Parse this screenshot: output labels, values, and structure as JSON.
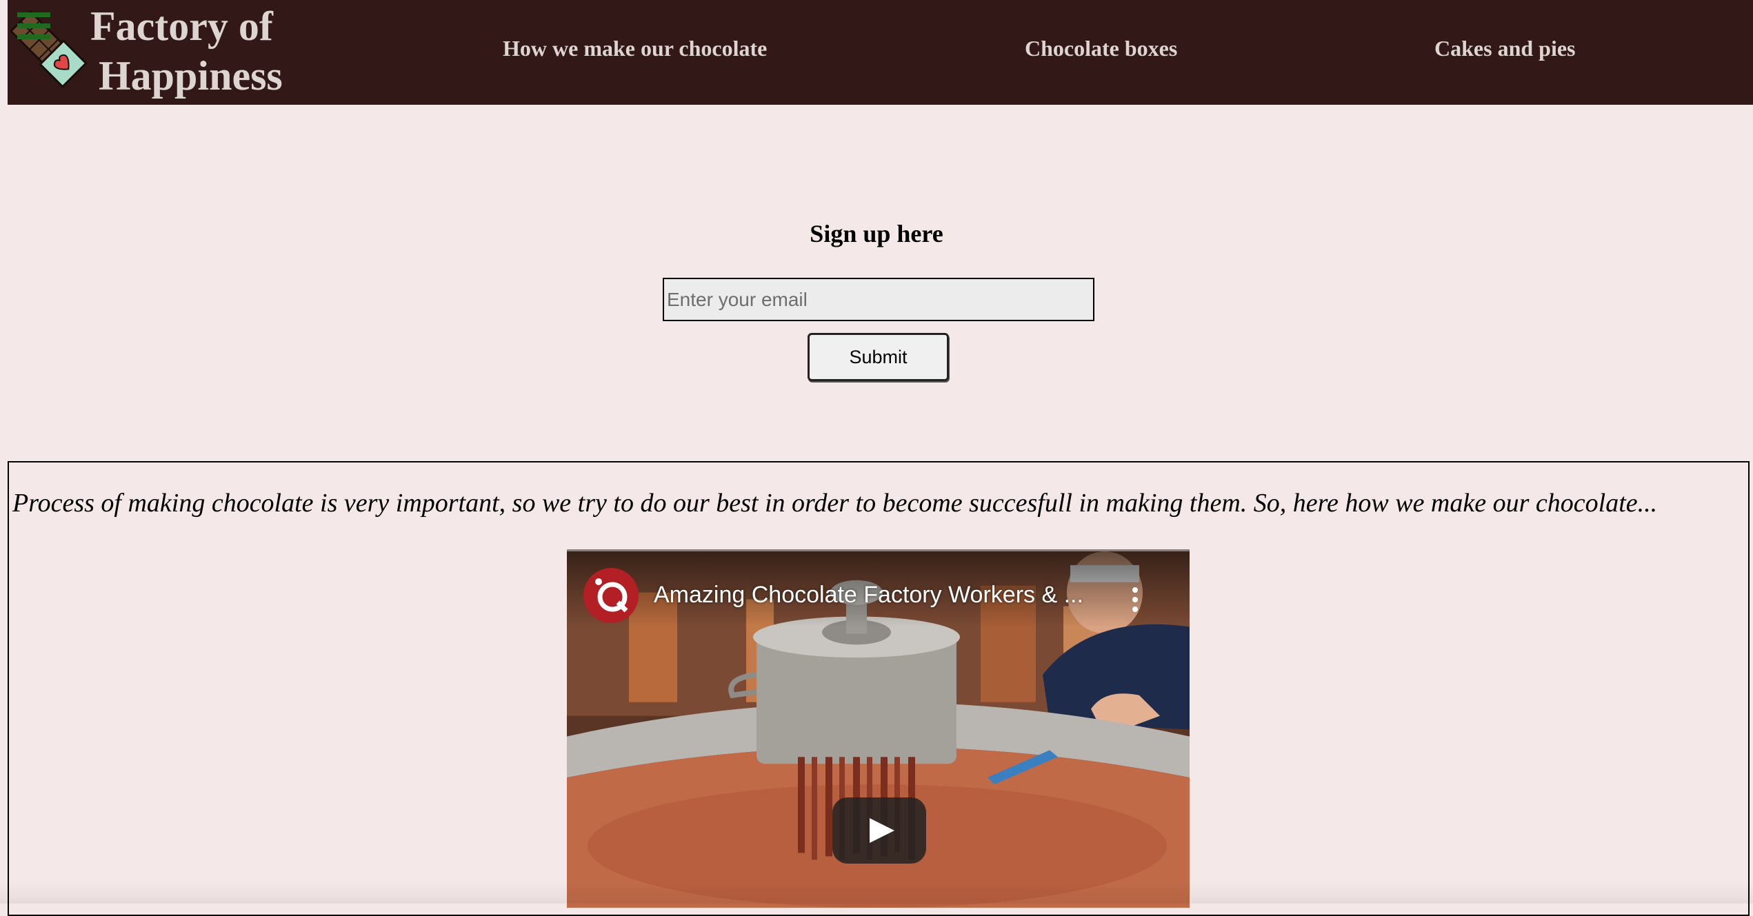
{
  "header": {
    "brand_line1": "Factory of",
    "brand_line2": "Happiness",
    "nav": [
      {
        "label": "How we make our chocolate"
      },
      {
        "label": "Chocolate boxes"
      },
      {
        "label": "Cakes and pies"
      }
    ]
  },
  "signup": {
    "title": "Sign up here",
    "email_placeholder": "Enter your email",
    "submit_label": "Submit"
  },
  "process": {
    "text": "Process of making chocolate is very important, so we try to do our best in order to become succesfull in making them. So, here how we make our chocolate..."
  },
  "video": {
    "title": "Amazing Chocolate Factory Workers & ..."
  },
  "colors": {
    "header_bg": "#331818",
    "page_bg": "#f5e8e8",
    "nav_text": "#dcd5d0"
  },
  "icons": [
    "hamburger-menu-icon",
    "chocolate-bar-logo-icon",
    "channel-logo-icon",
    "more-options-icon",
    "play-icon"
  ]
}
